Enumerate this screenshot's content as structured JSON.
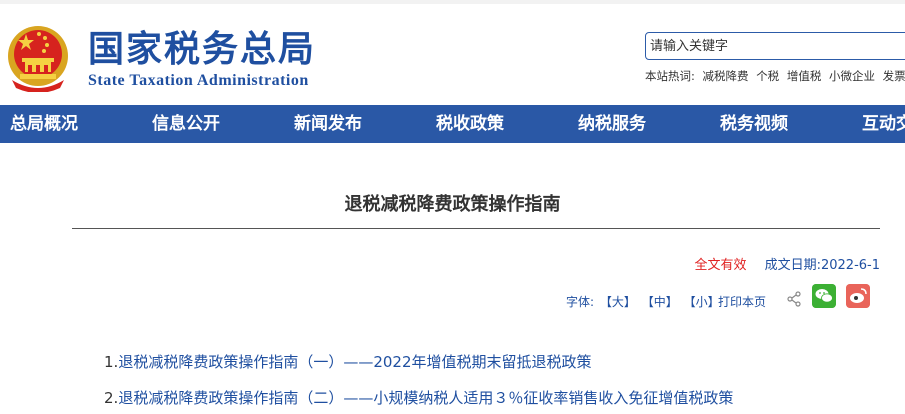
{
  "header": {
    "site_title_cn": "国家税务总局",
    "site_title_en": "State Taxation Administration",
    "emblem_icon": "national-emblem-icon"
  },
  "search": {
    "placeholder": "请输入关键字",
    "hot_label": "本站热词:",
    "hot_words": [
      "减税降费",
      "个税",
      "增值税",
      "小微企业",
      "发票"
    ]
  },
  "nav": {
    "items": [
      "总局概况",
      "信息公开",
      "新闻发布",
      "税收政策",
      "纳税服务",
      "税务视频",
      "互动交流"
    ]
  },
  "article": {
    "title": "退税减税降费政策操作指南",
    "validity": "全文有效",
    "date_label": "成文日期:",
    "date_value": "2022-6-1",
    "font_label": "字体:",
    "font_large": "【大】",
    "font_medium": "【中】",
    "font_small": "【小】",
    "print_label": "打印本页",
    "share_icons": [
      "share-icon",
      "wechat-icon",
      "weibo-icon"
    ],
    "links": [
      {
        "num": "1.",
        "text": "退税减税降费政策操作指南（一）——2022年增值税期末留抵退税政策"
      },
      {
        "num": "2.",
        "text": "退税减税降费政策操作指南（二）——小规模纳税人适用３％征收率销售收入免征增值税政策"
      }
    ]
  },
  "colors": {
    "brand_blue": "#2a58a6",
    "title_blue": "#1f4fa0",
    "valid_red": "#e02020",
    "wechat_green": "#3cb034",
    "weibo_red": "#e9645a"
  }
}
